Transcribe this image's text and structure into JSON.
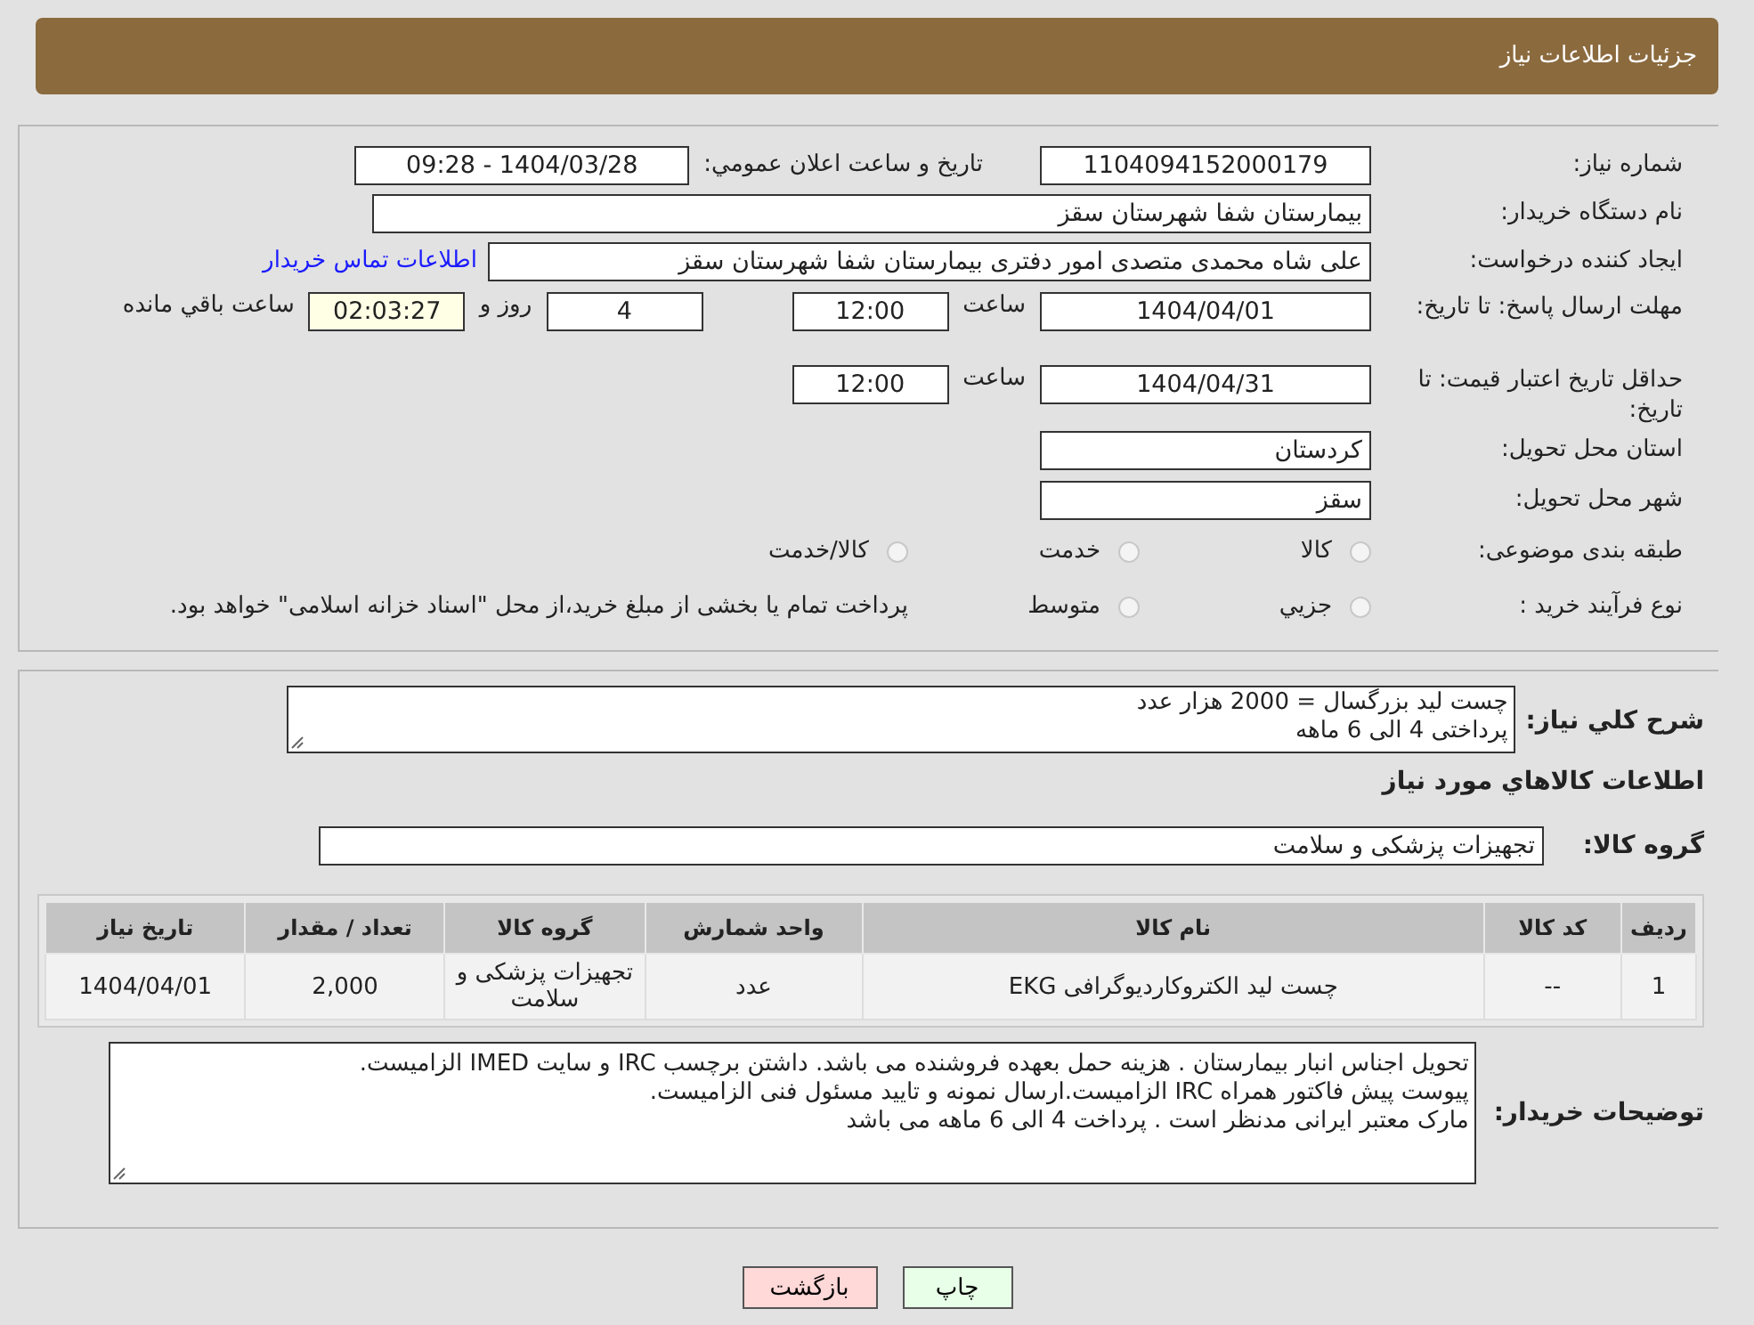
{
  "header": {
    "title": "جزئیات اطلاعات نیاز"
  },
  "form": {
    "need_number": {
      "label": "شماره نیاز:",
      "value": "1104094152000179"
    },
    "announce": {
      "label": "تاریخ و ساعت اعلان عمومي:",
      "value": "1404/03/28 - 09:28"
    },
    "buyer_org": {
      "label": "نام دستگاه خریدار:",
      "value": "بیمارستان شفا شهرستان سقز"
    },
    "requester": {
      "label": "ایجاد کننده درخواست:",
      "value": "علی شاه محمدی متصدی امور دفتری بیمارستان شفا شهرستان سقز",
      "link": "اطلاعات تماس خریدار"
    },
    "reply_deadline": {
      "label": "مهلت ارسال پاسخ: تا تاریخ:",
      "date": "1404/04/01",
      "time_label": "ساعت",
      "time": "12:00",
      "days": "4",
      "days_label": "روز و",
      "remaining": "02:03:27",
      "remaining_label": "ساعت باقي مانده"
    },
    "price_validity": {
      "label": "حداقل تاریخ اعتبار قیمت: تا تاریخ:",
      "date": "1404/04/31",
      "time_label": "ساعت",
      "time": "12:00"
    },
    "province": {
      "label": "استان محل تحویل:",
      "value": "کردستان"
    },
    "city": {
      "label": "شهر محل تحویل:",
      "value": "سقز"
    },
    "category": {
      "label": "طبقه بندی موضوعی:",
      "options": [
        {
          "label": "کالا",
          "selected": false
        },
        {
          "label": "خدمت",
          "selected": false
        },
        {
          "label": "کالا/خدمت",
          "selected": false
        }
      ]
    },
    "purchase_type": {
      "label": "نوع فرآیند خرید :",
      "options": [
        {
          "label": "جزيي",
          "selected": false
        },
        {
          "label": "متوسط",
          "selected": false
        }
      ],
      "note": "پرداخت تمام یا بخشی از مبلغ خرید،از محل \"اسناد خزانه اسلامی\" خواهد بود."
    }
  },
  "details": {
    "description": {
      "label": "شرح كلي نياز:",
      "lines": [
        "چست لید بزرگسال = 2000 هزار عدد",
        "پرداختی 4 الی 6 ماهه"
      ]
    },
    "goods_heading": "اطلاعات كالاهاي مورد نياز",
    "goods_group": {
      "label": "گروه کالا:",
      "value": "تجهیزات پزشکی و سلامت"
    },
    "table": {
      "columns": [
        "ردیف",
        "کد کالا",
        "نام کالا",
        "واحد شمارش",
        "گروه کالا",
        "تعداد / مقدار",
        "تاریخ نیاز"
      ],
      "rows": [
        [
          "1",
          "--",
          "چست لید الکتروکاردیوگرافی EKG",
          "عدد",
          "تجهیزات پزشکی و سلامت",
          "2,000",
          "1404/04/01"
        ]
      ]
    },
    "buyer_notes": {
      "label": "توضیحات خریدار:",
      "lines": [
        "تحویل اجناس  انبار بیمارستان . هزینه حمل بعهده فروشنده می باشد.  داشتن برچسب IRC  و سایت  IMED  الزامیست.",
        "پیوست پیش فاکتور همراه IRC  الزامیست.ارسال نمونه و تایید مسئول فنی الزامیست.",
        "مارک معتبر ایرانی مدنظر است . پرداخت 4 الی 6 ماهه می باشد"
      ]
    }
  },
  "buttons": [
    {
      "label": "چاپ",
      "kind": "print"
    },
    {
      "label": "بازگشت",
      "kind": "back"
    }
  ]
}
